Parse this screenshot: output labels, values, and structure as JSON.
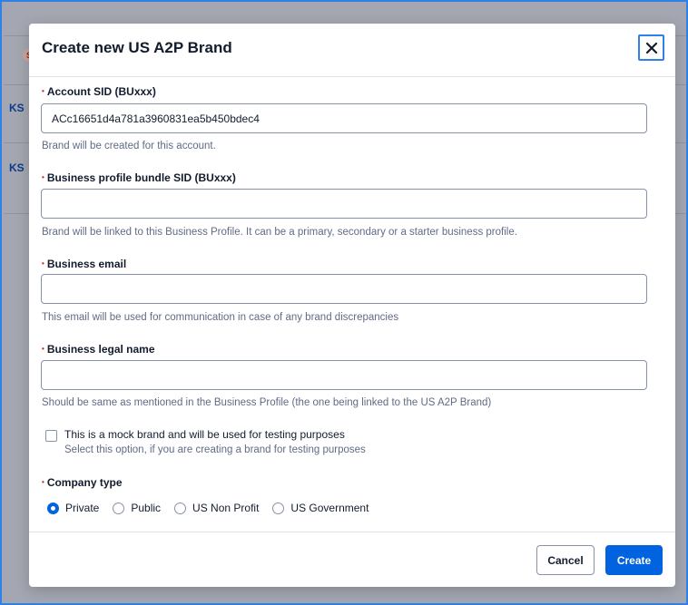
{
  "background": {
    "row_labels": [
      "KS",
      "KS"
    ],
    "badge_letter": "S"
  },
  "modal": {
    "title": "Create new US A2P Brand",
    "close_icon": "close-icon"
  },
  "form": {
    "required_marker": "•",
    "account_sid": {
      "label": "Account SID (BUxxx)",
      "value": "ACc16651d4a781a3960831ea5b450bdec4",
      "help": "Brand will be created for this account."
    },
    "business_profile": {
      "label": "Business profile bundle SID (BUxxx)",
      "value": "",
      "help": "Brand will be linked to this Business Profile. It can be a primary, secondary or a starter business profile."
    },
    "business_email": {
      "label": "Business email",
      "value": "",
      "help": "This email will be used for communication in case of any brand discrepancies"
    },
    "legal_name": {
      "label": "Business legal name",
      "value": "",
      "help": "Should be same as mentioned in the Business Profile (the one being linked to the US A2P Brand)"
    },
    "mock_brand": {
      "label": "This is a mock brand and will be used for testing purposes",
      "help": "Select this option, if you are creating a brand for testing purposes",
      "checked": false
    },
    "company_type": {
      "label": "Company type",
      "selected": "Private",
      "options": [
        "Private",
        "Public",
        "US Non Profit",
        "US Government"
      ]
    }
  },
  "footer": {
    "cancel_label": "Cancel",
    "create_label": "Create"
  },
  "colors": {
    "accent": "#0263e0",
    "focus_ring": "#2f80e8",
    "required": "#d61f1f"
  }
}
